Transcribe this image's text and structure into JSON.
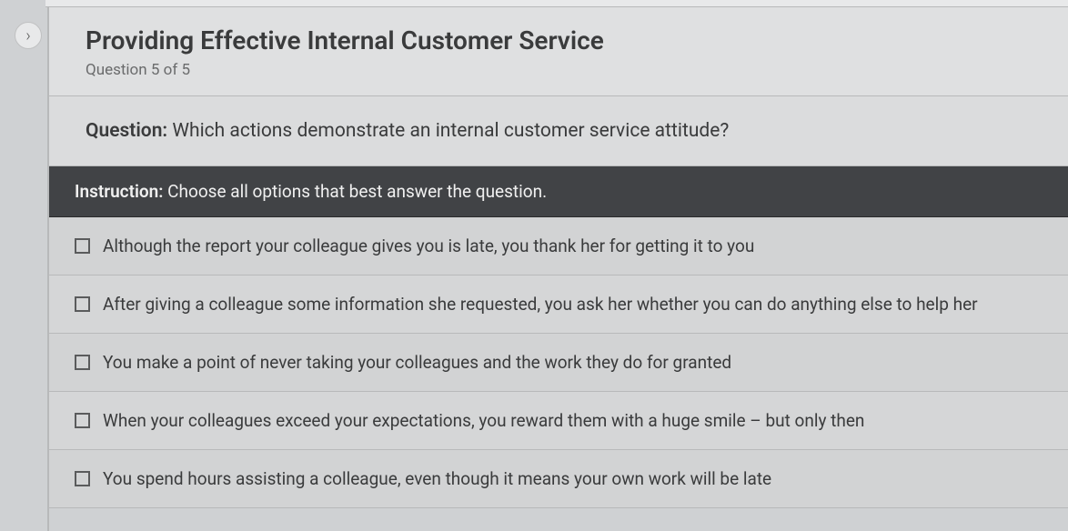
{
  "header": {
    "title": "Providing Effective Internal Customer Service",
    "subtitle": "Question 5 of 5"
  },
  "question": {
    "label": "Question:",
    "text": " Which actions demonstrate an internal customer service attitude?"
  },
  "instruction": {
    "label": "Instruction:",
    "text": " Choose all options that best answer the question."
  },
  "options": [
    {
      "text": "Although the report your colleague gives you is late, you thank her for getting it to you"
    },
    {
      "text": "After giving a colleague some information she requested, you ask her whether you can do anything else to help her"
    },
    {
      "text": "You make a point of never taking your colleagues and the work they do for granted"
    },
    {
      "text": "When your colleagues exceed your expectations, you reward them with a huge smile – but only then"
    },
    {
      "text": "You spend hours assisting a colleague, even though it means your own work will be late"
    }
  ],
  "expand_icon": "›"
}
